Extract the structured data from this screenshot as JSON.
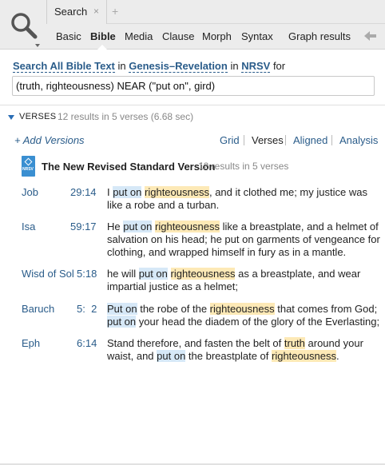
{
  "tabs": [
    {
      "label": "Search",
      "close": "×"
    }
  ],
  "tab_add": "+",
  "nav": {
    "items": [
      "Basic",
      "Bible",
      "Media",
      "Clause",
      "Morph",
      "Syntax",
      "Graph results"
    ],
    "active": "Bible"
  },
  "query": {
    "prefix": "Search All Bible Text",
    "in1": "in",
    "range": "Genesis–Revelation",
    "in2": "in",
    "version": "NRSV",
    "for": "for",
    "input_value": "(truth, righteousness) NEAR (\"put on\", gird)"
  },
  "results": {
    "section_label": "VERSES",
    "summary": "12 results in 5 verses (6.68 sec)",
    "add_versions": "+ Add Versions",
    "views": [
      "Grid",
      "Verses",
      "Aligned",
      "Analysis"
    ],
    "active_view": "Verses",
    "version_badge": "NRSV",
    "version_name": "The New Revised Standard Version",
    "version_count": "12 results in 5 verses",
    "rows": [
      {
        "book": "Job",
        "ref": "29:14",
        "segments": [
          {
            "t": "I "
          },
          {
            "t": "put on",
            "h": "blue"
          },
          {
            "t": " "
          },
          {
            "t": "righteousness",
            "h": "yellow"
          },
          {
            "t": ", and it clothed me; my justice was like a robe and a turban."
          }
        ]
      },
      {
        "book": "Isa",
        "ref": "59:17",
        "segments": [
          {
            "t": "He "
          },
          {
            "t": "put on",
            "h": "blue"
          },
          {
            "t": " "
          },
          {
            "t": "righteousness",
            "h": "yellow"
          },
          {
            "t": " like a breastplate, and a helmet of salvation on his head; he put on garments of vengeance for clothing, and wrapped himself in fury as in a mantle."
          }
        ]
      },
      {
        "book": "Wisd of Sol",
        "ref": "5:18",
        "segments": [
          {
            "t": "he will "
          },
          {
            "t": "put on",
            "h": "blue"
          },
          {
            "t": " "
          },
          {
            "t": "righteousness",
            "h": "yellow"
          },
          {
            "t": " as a breastplate, and wear impartial justice as a helmet;"
          }
        ]
      },
      {
        "book": "Baruch",
        "ref": "5:  2",
        "segments": [
          {
            "t": "Put on",
            "h": "blue"
          },
          {
            "t": " the robe of the "
          },
          {
            "t": "righteousness",
            "h": "yellow"
          },
          {
            "t": " that comes from God; "
          },
          {
            "t": "put on",
            "h": "blue"
          },
          {
            "t": " your head the diadem of the glory of the Everlasting;"
          }
        ]
      },
      {
        "book": "Eph",
        "ref": "6:14",
        "segments": [
          {
            "t": "Stand therefore, and fasten the belt of "
          },
          {
            "t": "truth",
            "h": "yellow"
          },
          {
            "t": " around your waist, and "
          },
          {
            "t": "put on",
            "h": "blue"
          },
          {
            "t": " the breastplate of "
          },
          {
            "t": "righteousness",
            "h": "yellow"
          },
          {
            "t": "."
          }
        ]
      }
    ]
  },
  "colors": {
    "link": "#2a5c8a",
    "highlight_phrase": "#d6e8f7",
    "highlight_term": "#fde9b6",
    "badge": "#3a8fd1"
  },
  "icons": [
    "search-icon",
    "tab-close-icon",
    "add-tab-icon",
    "back-arrow-icon",
    "collapse-triangle-icon",
    "bible-version-icon"
  ]
}
